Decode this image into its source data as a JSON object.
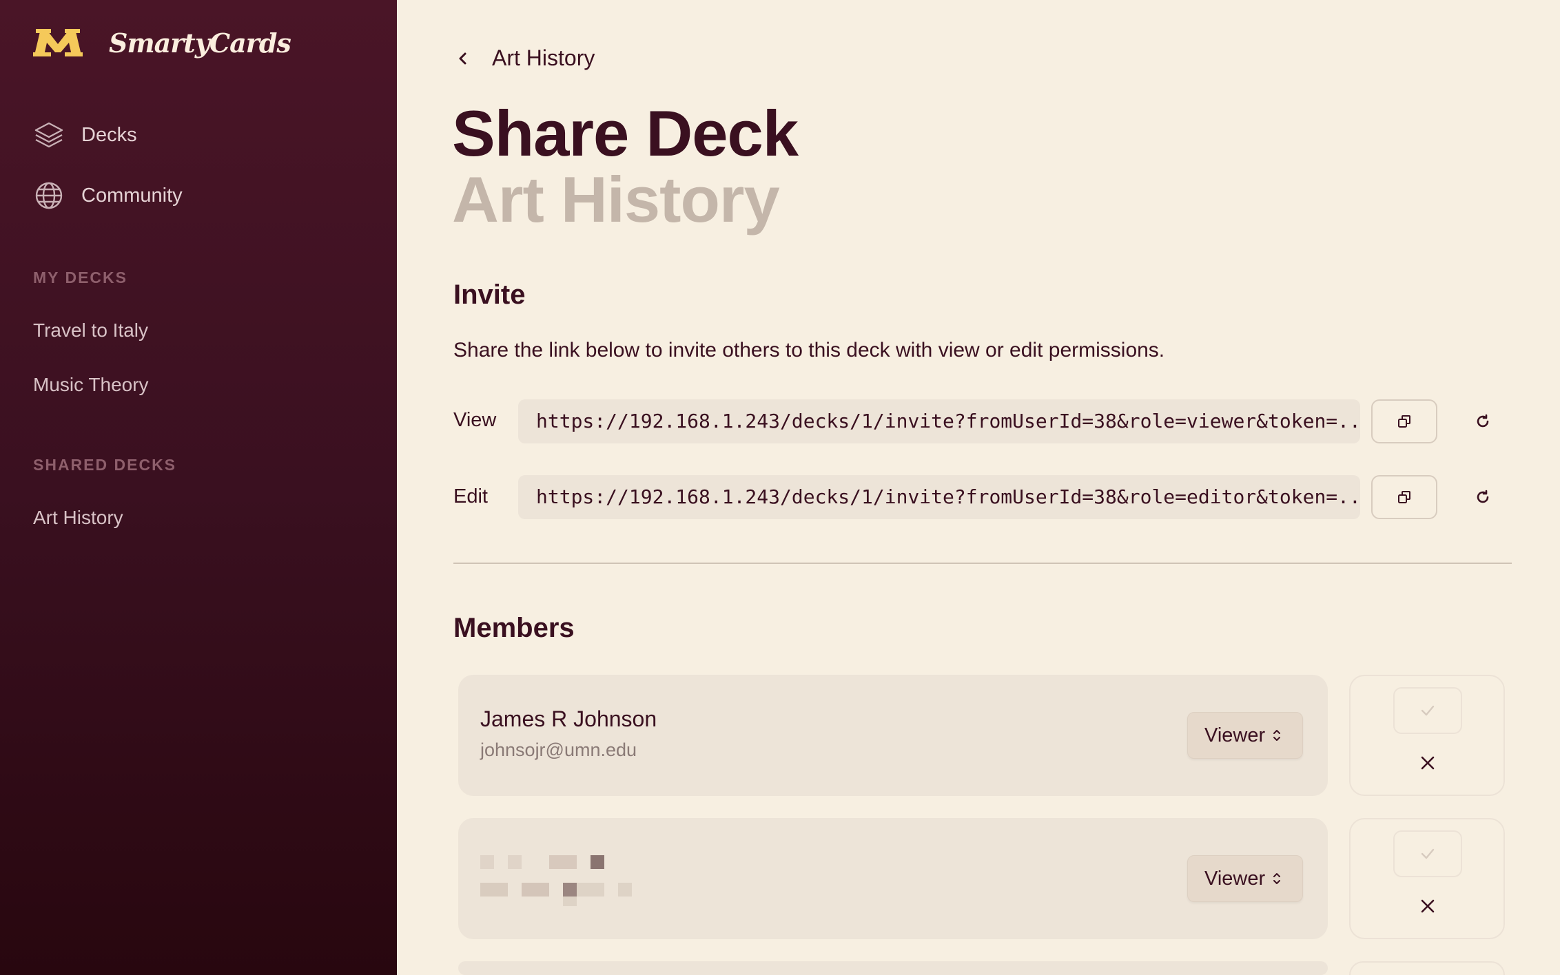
{
  "brand": {
    "name": "SmartyCards",
    "logo_icon": "m-logo-icon",
    "logo_color": "#f5c95a"
  },
  "sidebar": {
    "nav": [
      {
        "label": "Decks",
        "icon": "layers-icon"
      },
      {
        "label": "Community",
        "icon": "globe-icon"
      }
    ],
    "my_decks_label": "MY DECKS",
    "my_decks": [
      "Travel to Italy",
      "Music Theory"
    ],
    "shared_decks_label": "SHARED DECKS",
    "shared_decks": [
      "Art History"
    ]
  },
  "breadcrumb": {
    "label": "Art History",
    "icon": "chevron-left-icon"
  },
  "page": {
    "title": "Share Deck",
    "subtitle": "Art History"
  },
  "invite": {
    "heading": "Invite",
    "description": "Share the link below to invite others to this deck with view or edit permissions.",
    "view": {
      "label": "View",
      "url": "https://192.168.1.243/decks/1/invite?fromUserId=38&role=viewer&token=..."
    },
    "edit": {
      "label": "Edit",
      "url": "https://192.168.1.243/decks/1/invite?fromUserId=38&role=editor&token=..."
    }
  },
  "members": {
    "heading": "Members",
    "list": [
      {
        "name": "James R Johnson",
        "email": "johnsojr@umn.edu",
        "role": "Viewer"
      },
      {
        "name": "",
        "email": "",
        "role": "Viewer"
      }
    ]
  },
  "colors": {
    "sidebar": "#3a1020",
    "background": "#f7efe1",
    "accent_text": "#3a1020",
    "muted_title": "#c4b6aa"
  }
}
